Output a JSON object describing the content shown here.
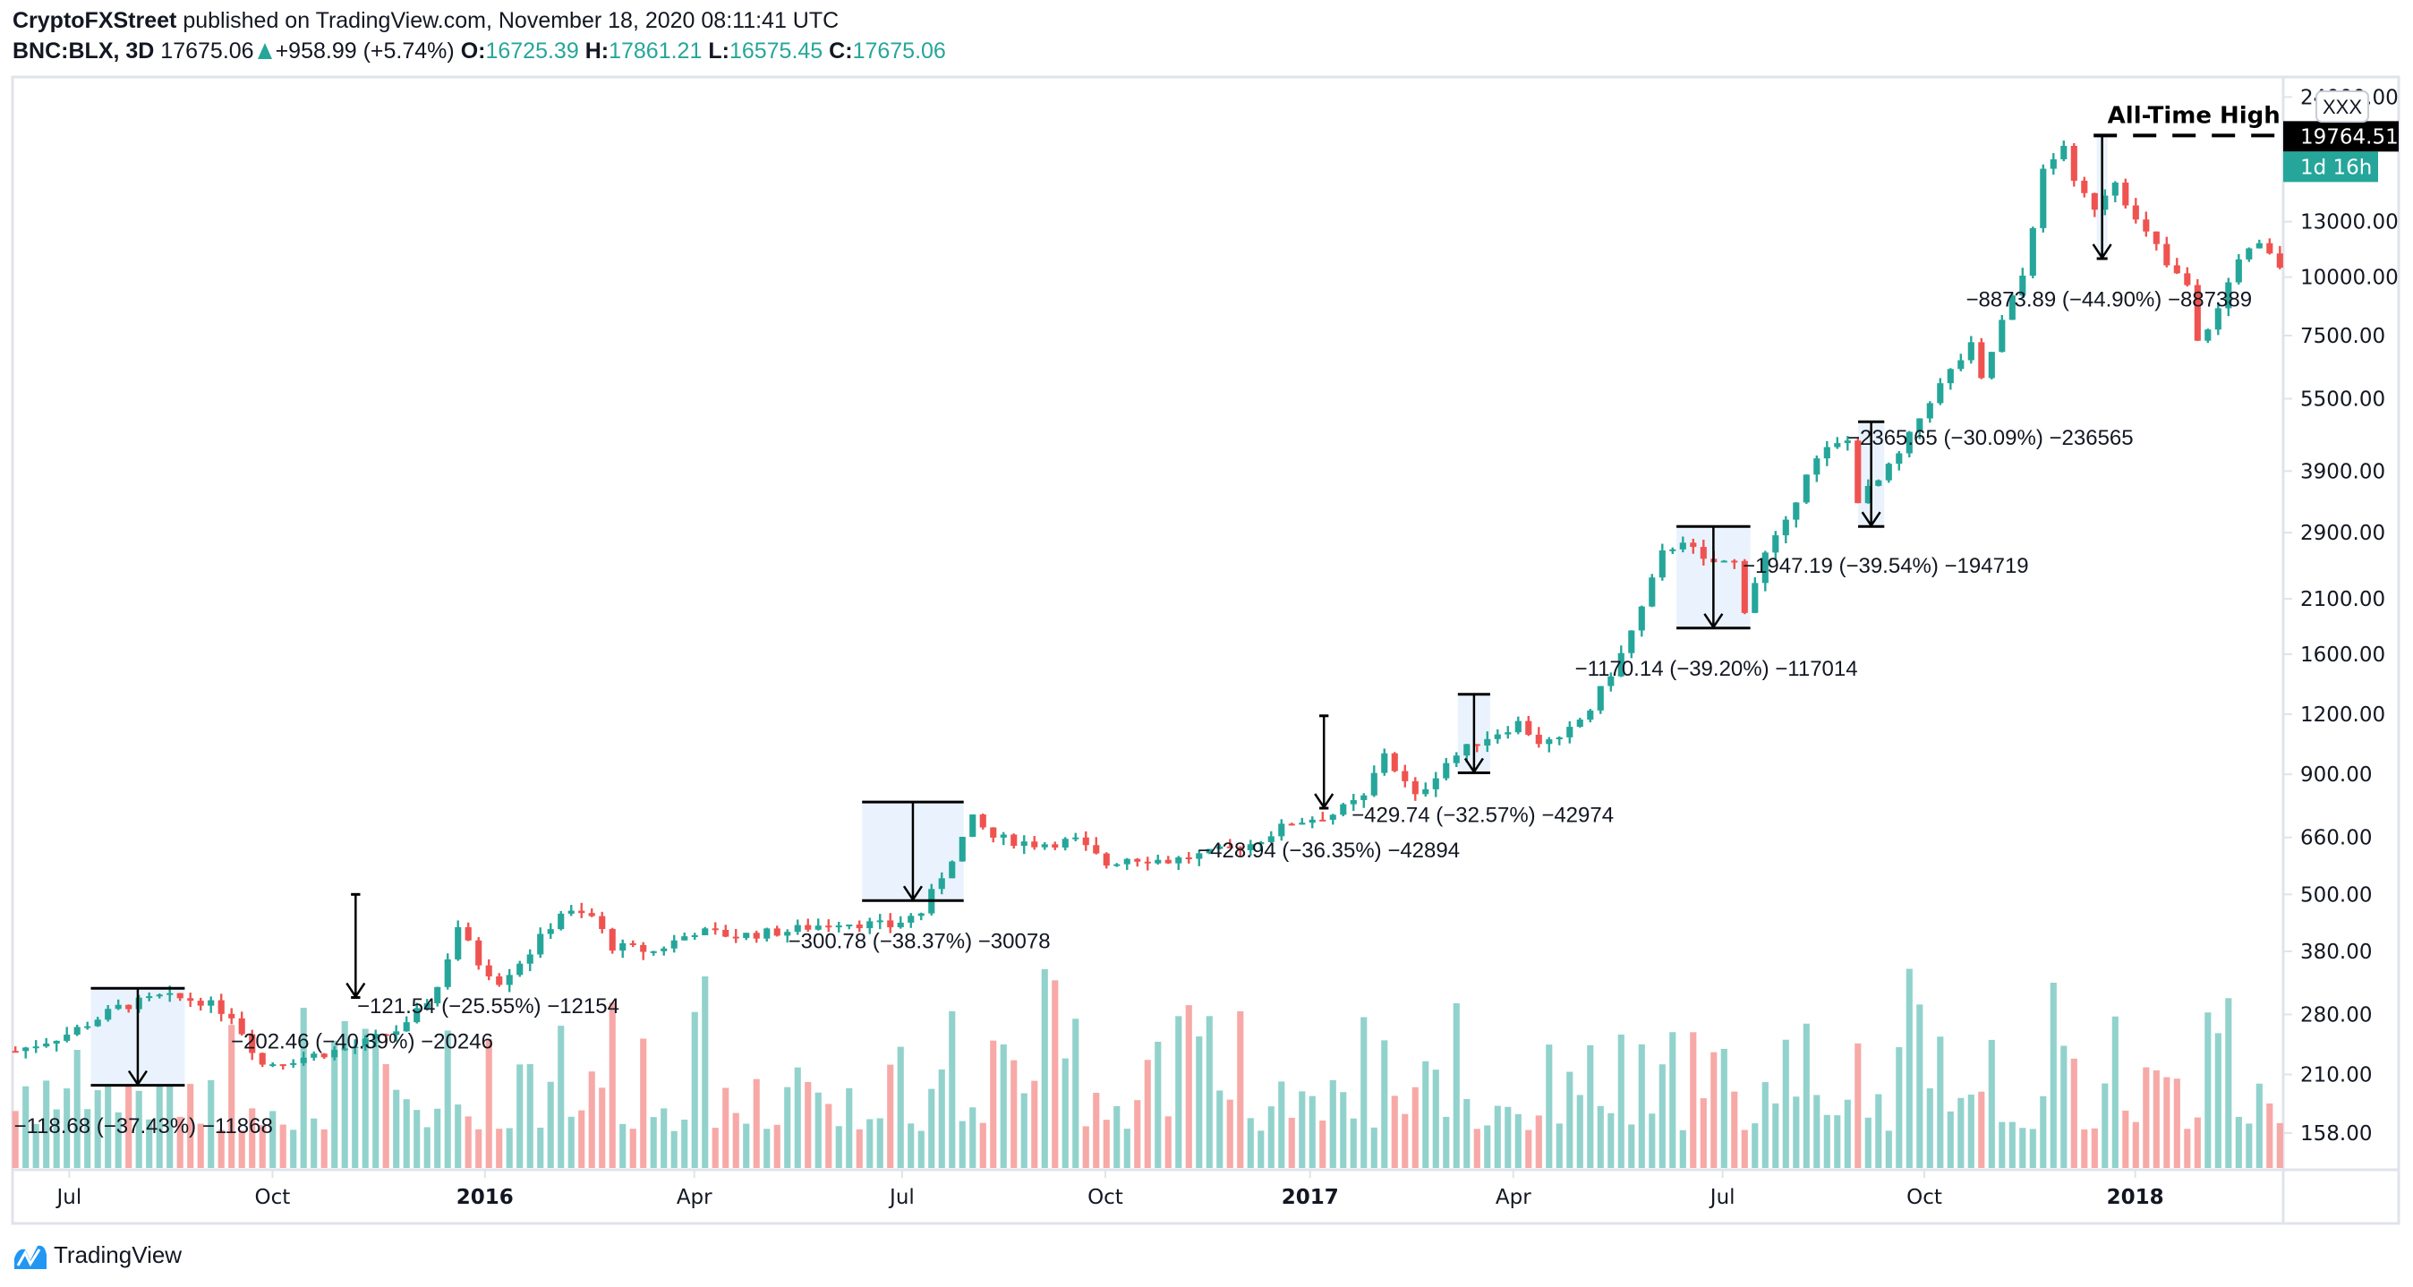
{
  "header": {
    "publisher": "CryptoFXStreet",
    "published_text": "published on TradingView.com, November 18, 2020 08:11:41 UTC",
    "symbol": "BNC:BLX, 3D",
    "last": "17675.06",
    "change": "+958.99 (+5.74%)",
    "open_label": "O:",
    "open": "16725.39",
    "high_label": "H:",
    "high": "17861.21",
    "low_label": "L:",
    "low": "16575.45",
    "close_label": "C:",
    "close": "17675.06"
  },
  "colors": {
    "up": "#26a69a",
    "down": "#ef5350",
    "up_volume": "#92d2cc",
    "down_volume": "#f7a9a7",
    "box_fill": "#eaf3fd",
    "axis_border": "#e0e3eb",
    "text": "#131722",
    "badge_dark": "#000000",
    "badge_teal": "#26a69a"
  },
  "price_axis": {
    "ticks": [
      "24000.00",
      "13000.00",
      "10000.00",
      "7500.00",
      "5500.00",
      "3900.00",
      "2900.00",
      "2100.00",
      "1600.00",
      "1200.00",
      "900.00",
      "660.00",
      "500.00",
      "380.00",
      "280.00",
      "210.00",
      "158.00"
    ],
    "price_badge": "19764.51",
    "countdown_badge": "1d 16h",
    "tooltip": "XXX"
  },
  "time_axis": {
    "ticks": [
      {
        "label": "Jul",
        "bold": false
      },
      {
        "label": "Oct",
        "bold": false
      },
      {
        "label": "2016",
        "bold": true
      },
      {
        "label": "Apr",
        "bold": false
      },
      {
        "label": "Jul",
        "bold": false
      },
      {
        "label": "Oct",
        "bold": false
      },
      {
        "label": "2017",
        "bold": true
      },
      {
        "label": "Apr",
        "bold": false
      },
      {
        "label": "Jul",
        "bold": false
      },
      {
        "label": "Oct",
        "bold": false
      },
      {
        "label": "2018",
        "bold": true
      }
    ]
  },
  "annotations": {
    "ath_label": "All-Time High",
    "measures": [
      {
        "text": "−118.68 (−37.43%) −11868",
        "from": 310,
        "to": 200,
        "box": true
      },
      {
        "text": "−202.46 (−40.39%) −20246",
        "from": null,
        "to": null,
        "box": false
      },
      {
        "text": "−121.54 (−25.55%) −12154",
        "from": 500,
        "to": 300,
        "box": false
      },
      {
        "text": "−300.78 (−38.37%) −30078",
        "from": 780,
        "to": 480,
        "box": true
      },
      {
        "text": "−428.94 (−36.35%) −42894",
        "from": 1180,
        "to": 750,
        "box": false
      },
      {
        "text": "−429.74 (−32.57%) −42974",
        "from": 1320,
        "to": 890,
        "box": false
      },
      {
        "text": "−1170.14 (−39.20%) −117014",
        "from": null,
        "to": null,
        "box": false
      },
      {
        "text": "−1947.19 (−39.54%) −194719",
        "from": 2950,
        "to": 1800,
        "box": true
      },
      {
        "text": "−2365.65 (−30.09%) −236565",
        "from": 4900,
        "to": 3000,
        "box": false
      },
      {
        "text": "−8873.89 (−44.90%) −887389",
        "from": 19764.51,
        "to": 10890,
        "box": false
      }
    ]
  },
  "logo": {
    "text": "TradingView"
  },
  "chart_data": {
    "type": "candlestick",
    "title": "BNC:BLX, 3D",
    "xlabel": "",
    "ylabel": "",
    "yscale": "log",
    "ylim": [
      140,
      26000
    ],
    "x_range": [
      "2015-06",
      "2018-03"
    ],
    "legend": "none",
    "grid": false,
    "approx_close_path": [
      [
        0,
        235
      ],
      [
        5,
        255
      ],
      [
        10,
        290
      ],
      [
        14,
        305
      ],
      [
        18,
        300
      ],
      [
        21,
        280
      ],
      [
        24,
        220
      ],
      [
        28,
        228
      ],
      [
        33,
        240
      ],
      [
        38,
        265
      ],
      [
        41,
        320
      ],
      [
        43,
        430
      ],
      [
        45,
        360
      ],
      [
        47,
        330
      ],
      [
        50,
        380
      ],
      [
        53,
        460
      ],
      [
        56,
        450
      ],
      [
        58,
        390
      ],
      [
        62,
        380
      ],
      [
        66,
        420
      ],
      [
        70,
        410
      ],
      [
        75,
        420
      ],
      [
        80,
        440
      ],
      [
        85,
        430
      ],
      [
        88,
        460
      ],
      [
        91,
        600
      ],
      [
        93,
        720
      ],
      [
        95,
        660
      ],
      [
        99,
        640
      ],
      [
        103,
        650
      ],
      [
        106,
        580
      ],
      [
        108,
        600
      ],
      [
        112,
        590
      ],
      [
        116,
        610
      ],
      [
        120,
        640
      ],
      [
        124,
        710
      ],
      [
        128,
        740
      ],
      [
        131,
        800
      ],
      [
        133,
        1000
      ],
      [
        134,
        920
      ],
      [
        136,
        800
      ],
      [
        139,
        950
      ],
      [
        142,
        1050
      ],
      [
        146,
        1150
      ],
      [
        148,
        1050
      ],
      [
        150,
        1050
      ],
      [
        153,
        1230
      ],
      [
        156,
        1600
      ],
      [
        158,
        2000
      ],
      [
        160,
        2600
      ],
      [
        162,
        2800
      ],
      [
        164,
        2500
      ],
      [
        167,
        2500
      ],
      [
        168,
        2000
      ],
      [
        170,
        2600
      ],
      [
        172,
        3000
      ],
      [
        174,
        3900
      ],
      [
        176,
        4300
      ],
      [
        178,
        4500
      ],
      [
        179,
        3400
      ],
      [
        181,
        3700
      ],
      [
        183,
        4200
      ],
      [
        186,
        5500
      ],
      [
        188,
        6300
      ],
      [
        190,
        7100
      ],
      [
        191,
        6000
      ],
      [
        193,
        8000
      ],
      [
        195,
        10000
      ],
      [
        197,
        16500
      ],
      [
        198,
        17500
      ],
      [
        199,
        19000
      ],
      [
        200,
        15500
      ],
      [
        202,
        14000
      ],
      [
        204,
        16000
      ],
      [
        206,
        13000
      ],
      [
        208,
        11500
      ],
      [
        209,
        10500
      ],
      [
        211,
        9500
      ],
      [
        212,
        7200
      ],
      [
        214,
        8500
      ],
      [
        216,
        11000
      ],
      [
        218,
        11500
      ],
      [
        219,
        11000
      ],
      [
        220,
        10500
      ]
    ],
    "volume_panel": true,
    "last_price": 17675.06,
    "all_time_high": 19764.51
  }
}
